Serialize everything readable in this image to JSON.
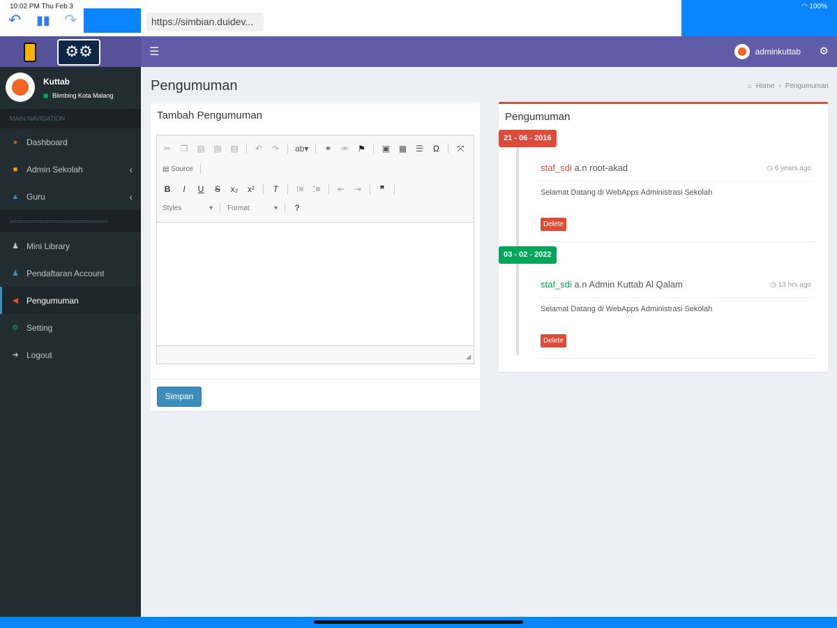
{
  "status": {
    "time": "10:02 PM  Thu Feb 3",
    "battery": "100%"
  },
  "browser": {
    "url": "https://simbian.duidev..."
  },
  "header": {
    "username": "adminkuttab"
  },
  "sidebar": {
    "user_name": "Kuttab",
    "user_location": "Blimbing Kota Malang",
    "nav_header": "MAIN NAVIGATION",
    "separator": "==============================",
    "items": [
      {
        "label": "Dashboard",
        "icon": "dashboard-icon",
        "color": "#dd4b39"
      },
      {
        "label": "Admin Sekolah",
        "icon": "briefcase-icon",
        "color": "#f39c12"
      },
      {
        "label": "Guru",
        "icon": "graduation-cap-icon",
        "color": "#3c8dbc"
      },
      {
        "label": "Mini Library",
        "icon": "users-icon",
        "color": "#b8c7ce"
      },
      {
        "label": "Pendaftaran Account",
        "icon": "user-plus-icon",
        "color": "#3c8dbc"
      },
      {
        "label": "Pengumuman",
        "icon": "megaphone-icon",
        "color": "#dd4b39"
      },
      {
        "label": "Setting",
        "icon": "gears-icon",
        "color": "#00a65a"
      },
      {
        "label": "Logout",
        "icon": "sign-out-icon",
        "color": "#b8c7ce"
      }
    ]
  },
  "page": {
    "title": "Pengumuman",
    "breadcrumb": {
      "home": "Home",
      "current": "Pengumuman"
    }
  },
  "form": {
    "title": "Tambah Pengumuman",
    "source_label": "Source",
    "styles_label": "Styles",
    "format_label": "Format",
    "submit_label": "Simpan"
  },
  "announcements": {
    "title": "Pengumuman",
    "items": [
      {
        "date": "21 - 06 - 2016",
        "date_color": "#dd4b39",
        "user": "staf_sdi",
        "user_color": "#dd4b39",
        "author": "a.n root-akad",
        "time": "6 years ago",
        "body": "Selamat Datang di WebApps Administrasi Sekolah",
        "delete_label": "Delete"
      },
      {
        "date": "03 - 02 - 2022",
        "date_color": "#00a65a",
        "user": "staf_sdi",
        "user_color": "#00a65a",
        "author": "a.n Admin Kuttab Al Qalam",
        "time": "13 hrs ago",
        "body": "Selamat Datang di WebApps Administrasi Sekolah",
        "delete_label": "Delete"
      }
    ]
  }
}
